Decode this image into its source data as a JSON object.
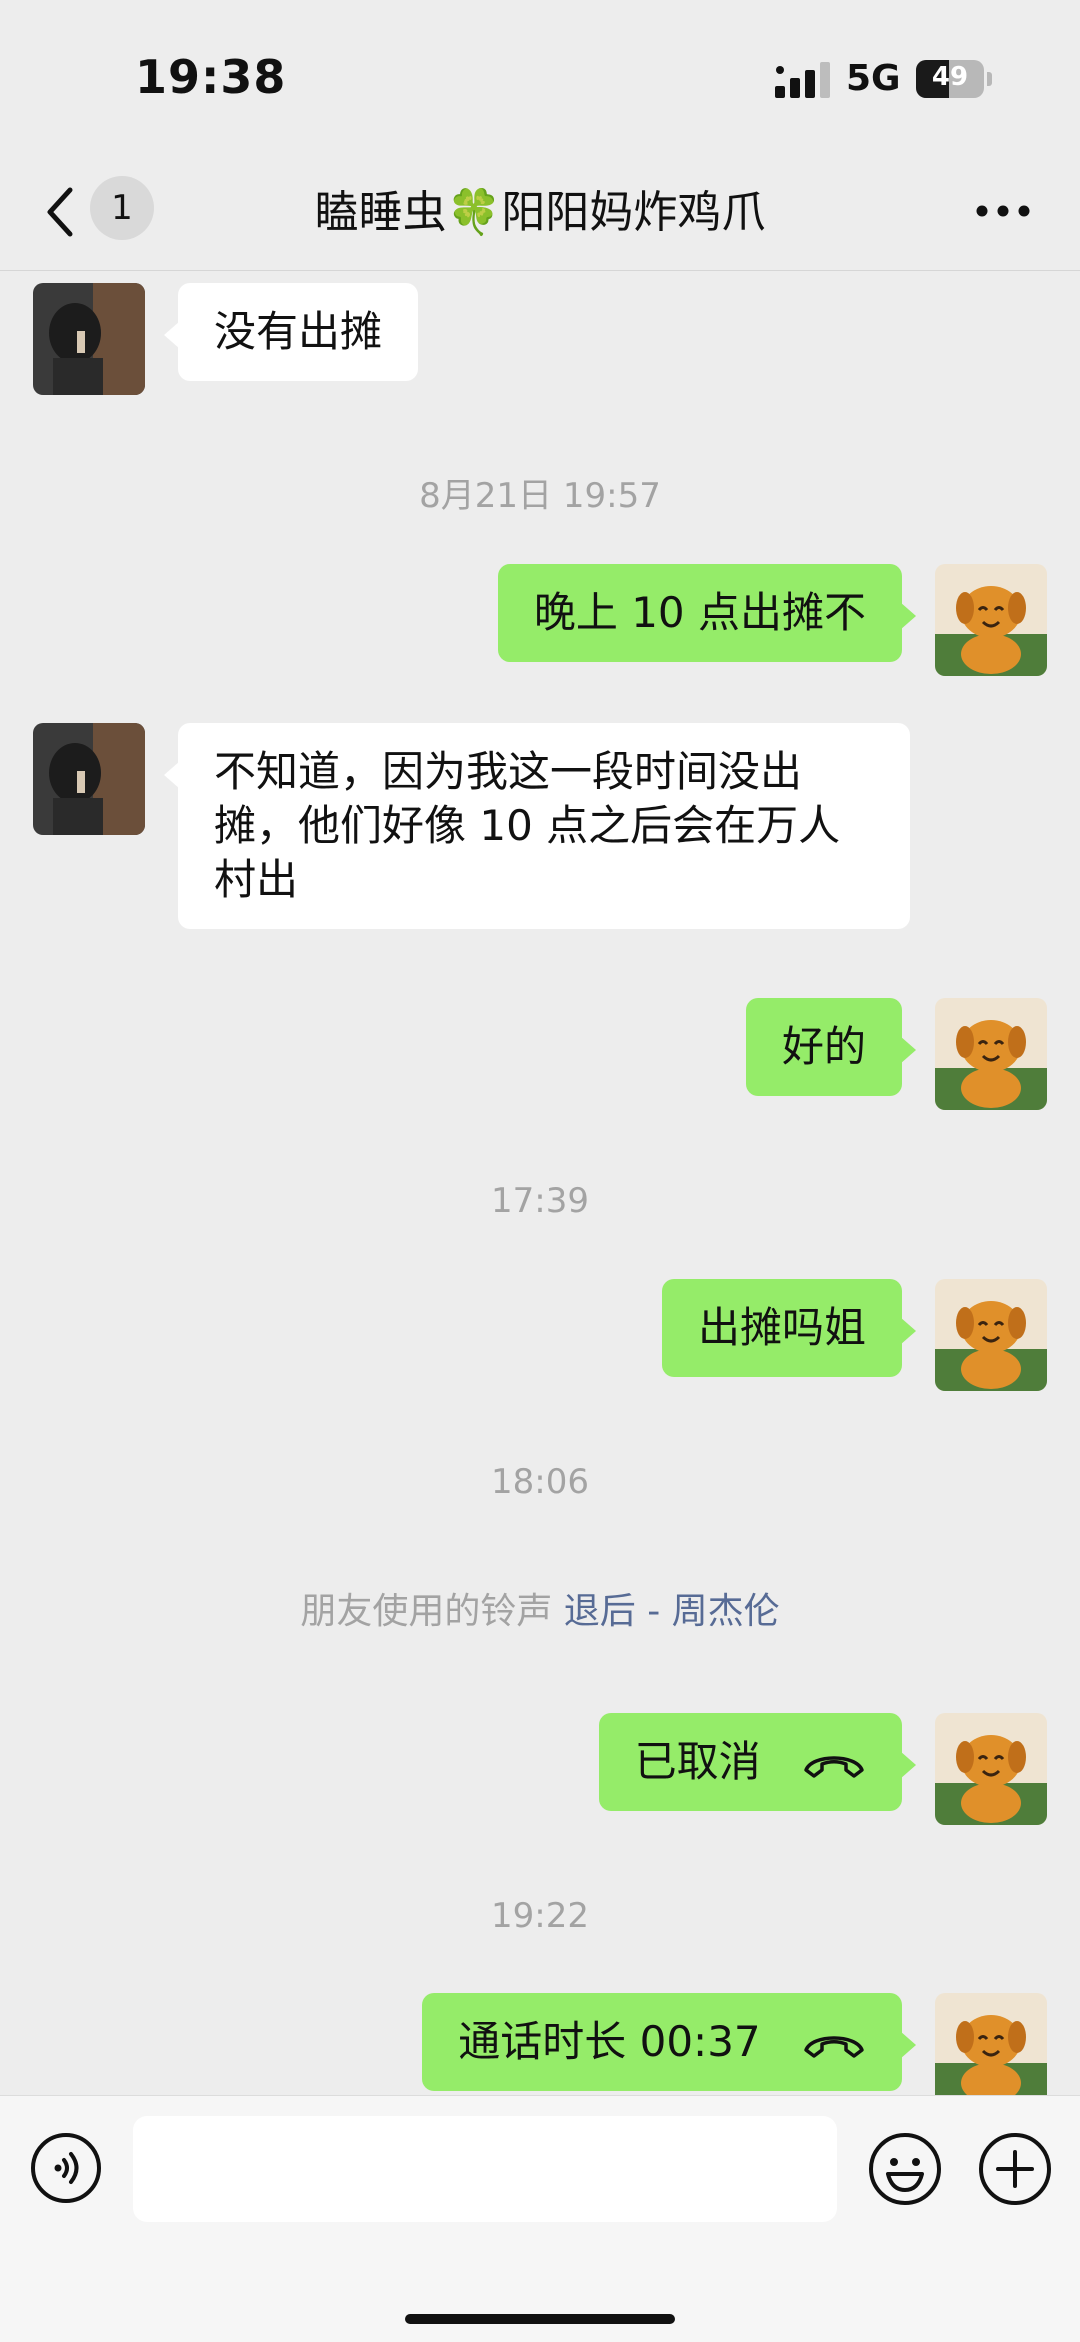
{
  "status_bar": {
    "time": "19:38",
    "network": "5G",
    "battery_percent": 49,
    "battery_label": "49"
  },
  "nav": {
    "unread_count": "1",
    "title": "瞌睡虫🍀阳阳妈炸鸡爪"
  },
  "messages": [
    {
      "from": "them",
      "text": "没有出摊"
    },
    {
      "timestamp": "8月21日 19:57"
    },
    {
      "from": "me",
      "text": "晚上 10 点出摊不"
    },
    {
      "from": "them",
      "text": "不知道，因为我这一段时间没出摊，他们好像 10 点之后会在万人村出"
    },
    {
      "from": "me",
      "text": "好的"
    },
    {
      "timestamp": "17:39"
    },
    {
      "from": "me",
      "text": "出摊吗姐"
    },
    {
      "timestamp": "18:06"
    },
    {
      "system": "朋友使用的铃声",
      "link": "退后 - 周杰伦"
    },
    {
      "from": "me",
      "text": "已取消",
      "icon": "phone-hangup-icon"
    },
    {
      "timestamp": "19:22"
    },
    {
      "from": "me",
      "text": "通话时长 00:37",
      "icon": "phone-hangup-icon"
    }
  ],
  "colors": {
    "outgoing_bubble": "#95ec69",
    "incoming_bubble": "#ffffff",
    "background": "#ededed",
    "link": "#576b95"
  },
  "input_bar": {
    "value": "",
    "placeholder": ""
  }
}
